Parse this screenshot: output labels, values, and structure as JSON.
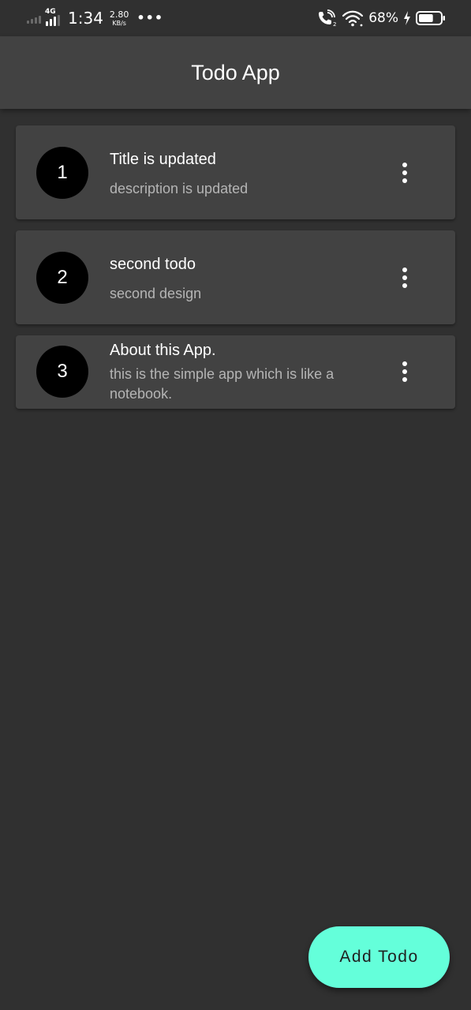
{
  "status_bar": {
    "network": "4G",
    "time": "1:34",
    "speed_value": "2.80",
    "speed_unit": "KB/s",
    "more_dots": "•••",
    "battery_percent": "68%",
    "icons": [
      "signal-bars-icon",
      "mobile-data-4g-icon",
      "volte-call-icon",
      "wifi-icon",
      "charging-bolt-icon",
      "battery-icon"
    ],
    "battery_level": 0.68
  },
  "app_bar": {
    "title": "Todo App"
  },
  "todos": [
    {
      "number": "1",
      "title": "Title is updated",
      "description": "description is updated",
      "menu_icon": "more-vertical-icon"
    },
    {
      "number": "2",
      "title": "second todo",
      "description": "second design",
      "menu_icon": "more-vertical-icon"
    },
    {
      "number": "3",
      "title": "About this App.",
      "description": "this is the simple app which is like a notebook.",
      "menu_icon": "more-vertical-icon"
    }
  ],
  "fab": {
    "label": "Add Todo"
  },
  "colors": {
    "background": "#303030",
    "app_bar": "#424242",
    "card": "#424242",
    "avatar": "#000000",
    "fab": "#64ffda",
    "description_text": "#b5b5b5"
  }
}
